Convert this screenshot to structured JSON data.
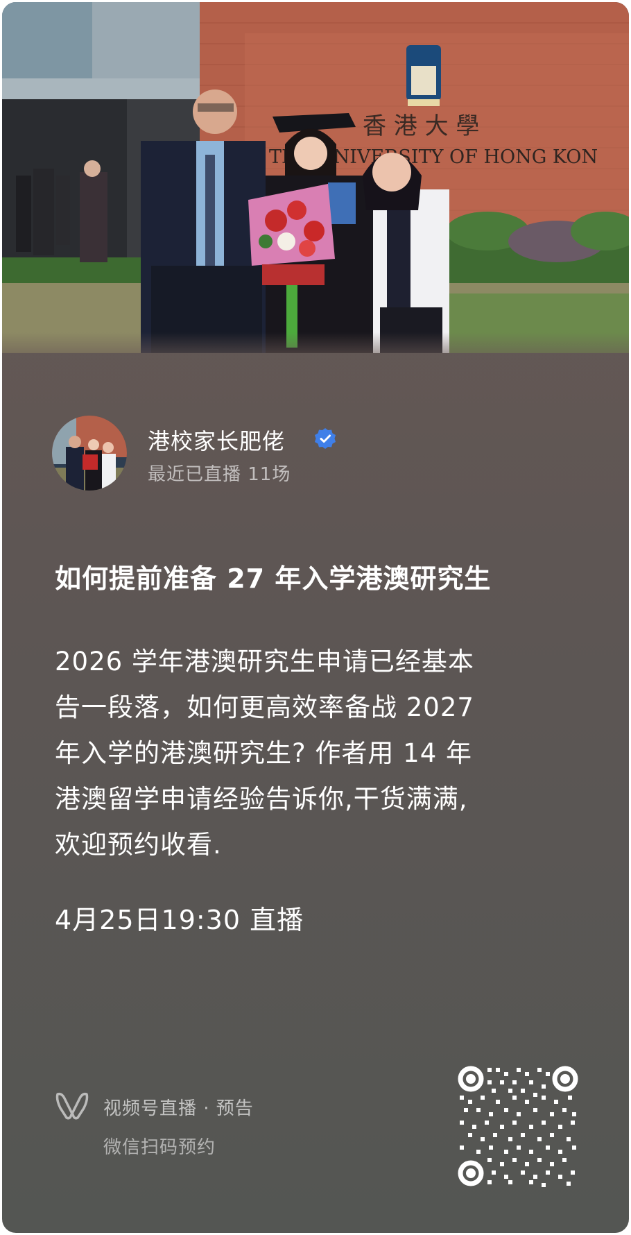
{
  "photo": {
    "description_icon": "graduation-photo",
    "building_sign": "THE UNIVERSITY OF HONG KONG",
    "building_sign_chinese": "香港大學"
  },
  "author": {
    "name": "港校家长肥佬",
    "verified_icon": "verified-badge-icon",
    "subtitle": "最近已直播 11场"
  },
  "post": {
    "title": "如何提前准备 27 年入学港澳研究生",
    "description_lines": [
      "2026 学年港澳研究生申请已经基本",
      "告一段落，如何更高效率备战 2027",
      "年入学的港澳研究生? 作者用 14 年",
      "港澳留学申请经验告诉你,干货满满,",
      "欢迎预约收看."
    ],
    "schedule": "4月25日19:30 直播"
  },
  "footer": {
    "channel_icon": "video-channel-icon",
    "channel_label": "视频号直播 · 预告",
    "scan_hint": "微信扫码预约",
    "qr_icon": "qr-code-icon"
  },
  "colors": {
    "card_top": "#6a5a56",
    "card_bottom": "#545653",
    "verified_blue": "#3f7fe8",
    "text_primary": "#ffffff"
  }
}
